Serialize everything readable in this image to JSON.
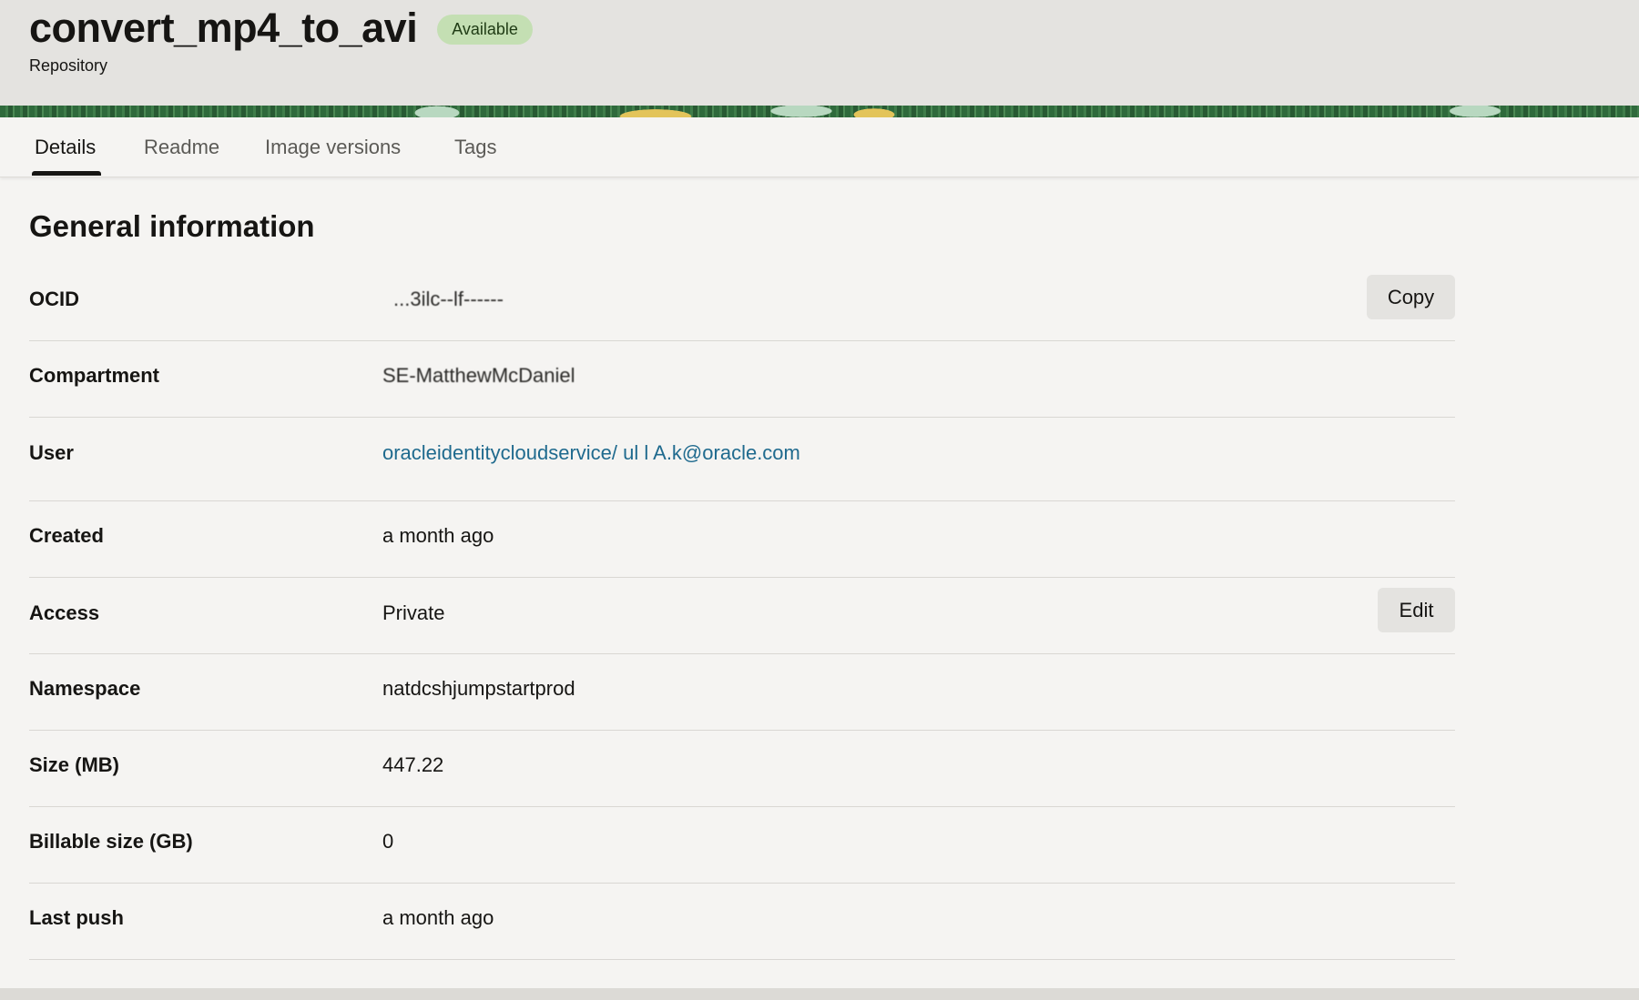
{
  "header": {
    "title": "convert_mp4_to_avi",
    "status_badge": "Available",
    "subtitle": "Repository"
  },
  "tabs": [
    {
      "label": "Details",
      "active": true
    },
    {
      "label": "Readme",
      "active": false
    },
    {
      "label": "Image versions",
      "active": false
    },
    {
      "label": "Tags",
      "active": false
    }
  ],
  "section_title": "General information",
  "fields": [
    {
      "label": "OCID",
      "value": "...3ilc--lf------",
      "action": "Copy"
    },
    {
      "label": "Compartment",
      "value": "SE-MatthewMcDaniel"
    },
    {
      "label": "User",
      "value": "oracleidentitycloudservice/ ul   l  A.k@oracle.com"
    },
    {
      "label": "Created",
      "value": "a month ago"
    },
    {
      "label": "Access",
      "value": "Private",
      "action": "Edit"
    },
    {
      "label": "Namespace",
      "value": "natdcshjumpstartprod"
    },
    {
      "label": "Size (MB)",
      "value": "447.22"
    },
    {
      "label": "Billable size (GB)",
      "value": "0"
    },
    {
      "label": "Last push",
      "value": "a month ago"
    }
  ],
  "colors": {
    "badge_bg": "#c4dfb3",
    "link": "#1f6a8e",
    "header_bg": "#e4e3e0",
    "page_bg": "#f5f4f2"
  }
}
